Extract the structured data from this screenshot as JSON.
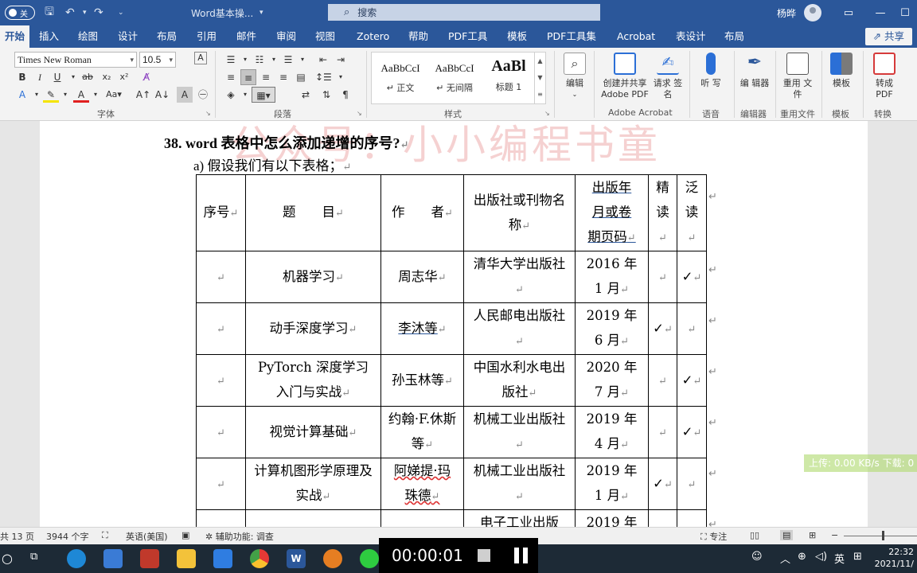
{
  "titlebar": {
    "toggle_label": "关",
    "doc_title": "Word基本操...",
    "search_placeholder": "搜索",
    "user_name": "杨晔"
  },
  "menu": {
    "tabs": [
      "开始",
      "插入",
      "绘图",
      "设计",
      "布局",
      "引用",
      "邮件",
      "审阅",
      "视图",
      "Zotero",
      "帮助",
      "PDF工具",
      "模板",
      "PDF工具集",
      "Acrobat",
      "表设计",
      "布局"
    ],
    "share": "共享"
  },
  "ribbon": {
    "font_name": "Times New Roman",
    "font_size": "10.5",
    "group_font": "字体",
    "group_paragraph": "段落",
    "group_styles": "样式",
    "styles": [
      {
        "sample": "AaBbCcI",
        "name": "↵ 正文"
      },
      {
        "sample": "AaBbCcI",
        "name": "↵ 无间隔"
      },
      {
        "sample": "AaBl",
        "name": "标题 1"
      }
    ],
    "edit": "编辑",
    "create_share_pdf": "创建并共享 Adobe PDF",
    "request_sign": "请求 签名",
    "group_acrobat": "Adobe Acrobat",
    "listen": "听 写",
    "group_voice": "语音",
    "editor": "编 辑器",
    "group_editor": "编辑器",
    "reuse": "重用 文件",
    "group_reuse": "重用文件",
    "template": "模板",
    "group_template": "模板",
    "convert_pdf": "转成 PDF",
    "group_convert": "转换"
  },
  "document": {
    "watermark": "公众号：小小编程书童",
    "heading": "38.  word 表格中怎么添加递增的序号?",
    "subline": "a)    假设我们有以下表格；",
    "table": {
      "headers": [
        "序号",
        "题　　目",
        "作　　者",
        "出版社或刊物名称",
        "出版年月或卷期页码",
        "精读",
        "泛读"
      ],
      "rows": [
        {
          "title": "机器学习",
          "author": "周志华",
          "publisher": "清华大学出版社",
          "date": "2016 年 1 月",
          "intensive": "",
          "extensive": "✓"
        },
        {
          "title": "动手深度学习",
          "author": "李沐等",
          "publisher": "人民邮电出版社",
          "date": "2019 年 6 月",
          "intensive": "✓",
          "extensive": ""
        },
        {
          "title": "PyTorch 深度学习入门与实战",
          "author": "孙玉林等",
          "publisher": "中国水利水电出版社",
          "date": "2020 年 7 月",
          "intensive": "",
          "extensive": "✓"
        },
        {
          "title": "视觉计算基础",
          "author": "约翰·F.休斯等",
          "publisher": "机械工业出版社",
          "date": "2019 年 4 月",
          "intensive": "",
          "extensive": "✓"
        },
        {
          "title": "计算机图形学原理及实战",
          "author": "阿娣提·玛珠德",
          "publisher": "机械工业出版社",
          "date": "2019 年 1 月",
          "intensive": "✓",
          "extensive": ""
        },
        {
          "title": "...",
          "author": "...",
          "publisher": "电子工业出版",
          "date": "2019 年",
          "intensive": "",
          "extensive": ""
        }
      ]
    }
  },
  "status": {
    "pages": "共 13 页",
    "words": "3944 个字",
    "language": "英语(美国)",
    "accessibility": "辅助功能: 调查",
    "focus": "专注"
  },
  "overlay": {
    "network": "上传: 0.00 KB/s   下载: 0"
  },
  "taskbar": {
    "timer": "00:00:01",
    "ime": "英",
    "time": "22:32",
    "date": "2021/11/"
  }
}
